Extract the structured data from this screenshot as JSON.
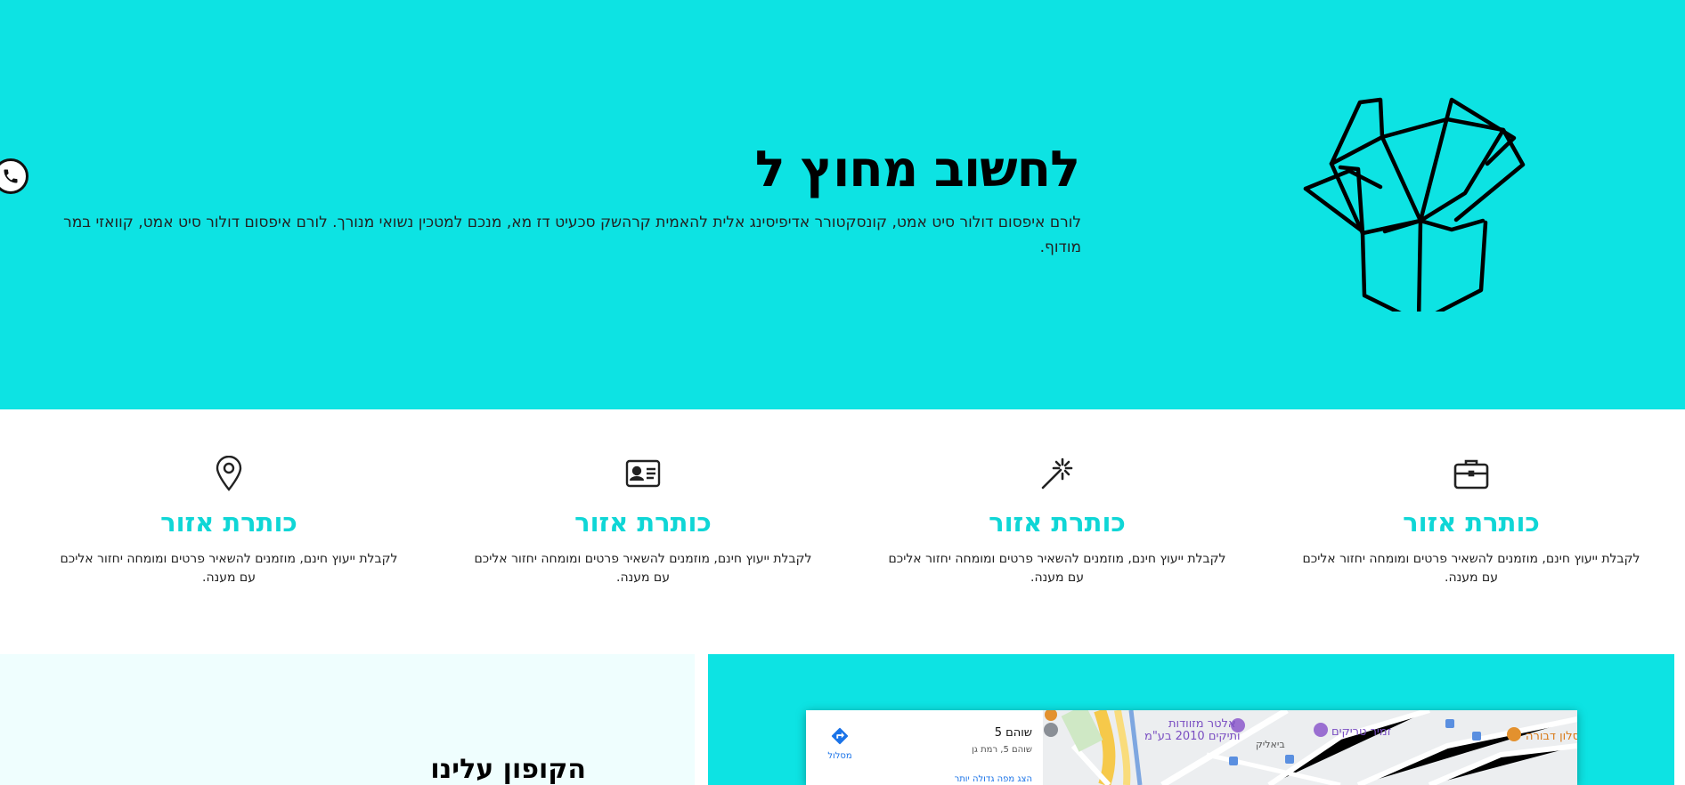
{
  "hero": {
    "title": "לחשוב מחוץ ל",
    "text": "לורם איפסום דולור סיט אמט, קונסקטורר אדיפיסינג אלית להאמית קרהשק סכעיט דז מא, מנכם למטכין נשואי מנורך. לורם איפסום דולור סיט אמט, קוואזי במר מודוף."
  },
  "features": [
    {
      "icon": "briefcase-icon",
      "title": "כותרת אזור",
      "text": "לקבלת ייעוץ חינם, מוזמנים להשאיר פרטים ומומחה יחזור אליכם עם מענה."
    },
    {
      "icon": "magic-wand-icon",
      "title": "כותרת אזור",
      "text": "לקבלת ייעוץ חינם, מוזמנים להשאיר פרטים ומומחה יחזור אליכם עם מענה."
    },
    {
      "icon": "id-card-icon",
      "title": "כותרת אזור",
      "text": "לקבלת ייעוץ חינם, מוזמנים להשאיר פרטים ומומחה יחזור אליכם עם מענה."
    },
    {
      "icon": "map-pin-icon",
      "title": "כותרת אזור",
      "text": "לקבלת ייעוץ חינם, מוזמנים להשאיר פרטים ומומחה יחזור אליכם עם מענה."
    }
  ],
  "coupon": {
    "title": "הקופון עלינו"
  },
  "map": {
    "place_name": "שוהם 5",
    "address": "שוהם 5, רמת גן",
    "larger_map": "הצג מפה גדולה יותר",
    "route": "מסלול",
    "labels": {
      "elter": "אלטר מזוודות",
      "elter2": "ותיקים 2010 בע\"מ",
      "zamir": "זמיר טריקים",
      "salon": "סלון דבורה",
      "bialik": "ביאליק"
    }
  },
  "colors": {
    "accent": "#0de3e3",
    "title_accent": "#0fd6d6",
    "light_bg": "#effefe"
  }
}
